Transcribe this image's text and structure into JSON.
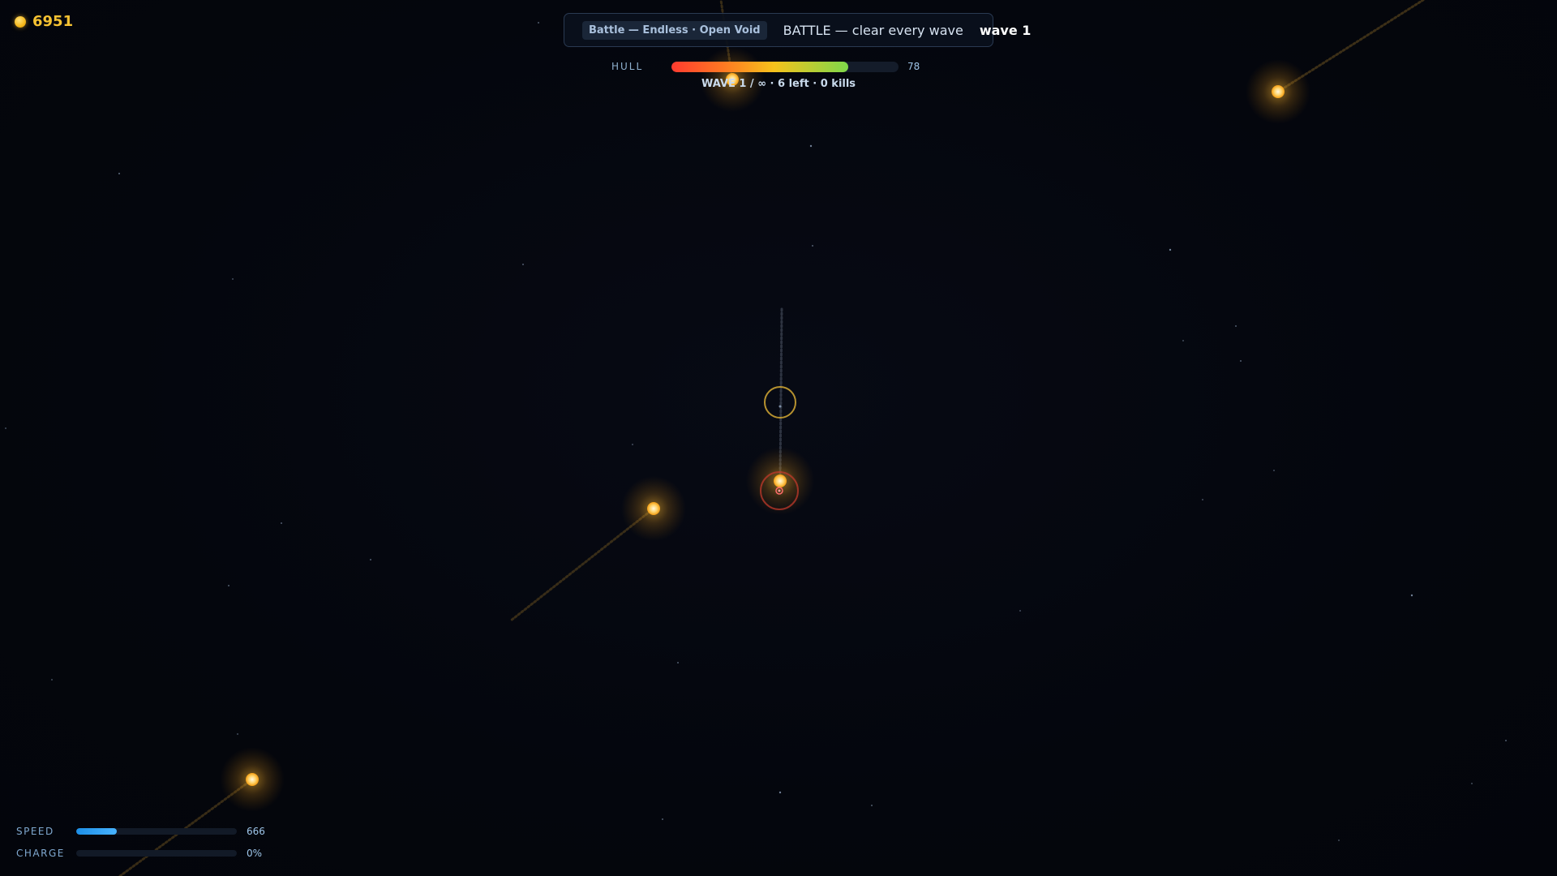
{
  "credits": {
    "icon": "coin-icon",
    "value": "6951",
    "color": "#f5c232"
  },
  "banner": {
    "mode": "Battle — Endless · Open Void",
    "objective": "BATTLE — clear every wave",
    "wave": "wave 1"
  },
  "hull": {
    "label": "HULL",
    "value": "78",
    "fraction": 0.78
  },
  "wave_info": "WAVE 1 / ∞ · 6 left · 0 kills",
  "gauges": {
    "speed": {
      "label": "SPEED",
      "value": "666",
      "fraction": 0.25
    },
    "charge": {
      "label": "CHARGE",
      "value": "0%",
      "fraction": 0
    }
  },
  "colors": {
    "background": "#04060d",
    "enemy_glow": "#ffb52e",
    "reticle": "#c9a032",
    "player_ring": "#c0392b"
  }
}
